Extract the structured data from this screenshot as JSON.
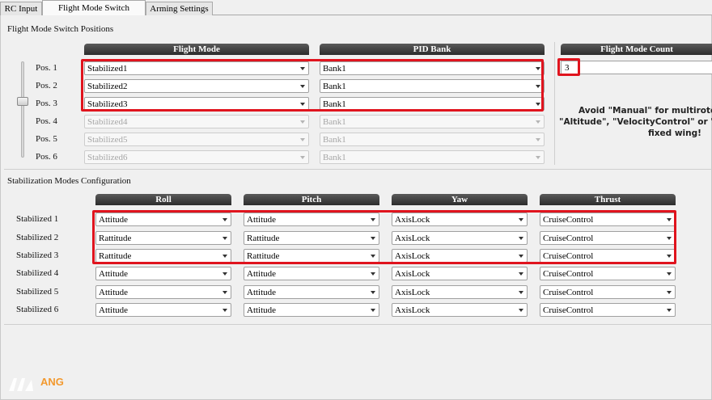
{
  "tabs": [
    {
      "label": "RC Input",
      "active": false
    },
    {
      "label": "Flight Mode Switch Settings",
      "active": true
    },
    {
      "label": "Arming Settings",
      "active": false
    }
  ],
  "flight_mode_section": {
    "title": "Flight Mode Switch Positions",
    "headers": {
      "flight_mode": "Flight Mode",
      "pid_bank": "PID Bank",
      "count": "Flight Mode Count"
    },
    "positions": [
      {
        "label": "Pos. 1",
        "mode": "Stabilized1",
        "bank": "Bank1",
        "enabled": true
      },
      {
        "label": "Pos. 2",
        "mode": "Stabilized2",
        "bank": "Bank1",
        "enabled": true
      },
      {
        "label": "Pos. 3",
        "mode": "Stabilized3",
        "bank": "Bank1",
        "enabled": true
      },
      {
        "label": "Pos. 4",
        "mode": "Stabilized4",
        "bank": "Bank1",
        "enabled": false
      },
      {
        "label": "Pos. 5",
        "mode": "Stabilized5",
        "bank": "Bank1",
        "enabled": false
      },
      {
        "label": "Pos. 6",
        "mode": "Stabilized6",
        "bank": "Bank1",
        "enabled": false
      }
    ],
    "flight_mode_count": "3",
    "warning_lines": [
      "Avoid \"Manual\" for multirotors!",
      "\"Altitude\", \"VelocityControl\" or \"Cr",
      "fixed wing!"
    ]
  },
  "stabilization_section": {
    "title": "Stabilization Modes Configuration",
    "headers": {
      "roll": "Roll",
      "pitch": "Pitch",
      "yaw": "Yaw",
      "thrust": "Thrust"
    },
    "rows": [
      {
        "label": "Stabilized 1",
        "roll": "Attitude",
        "pitch": "Attitude",
        "yaw": "AxisLock",
        "thrust": "CruiseControl"
      },
      {
        "label": "Stabilized 2",
        "roll": "Rattitude",
        "pitch": "Rattitude",
        "yaw": "AxisLock",
        "thrust": "CruiseControl"
      },
      {
        "label": "Stabilized 3",
        "roll": "Rattitude",
        "pitch": "Rattitude",
        "yaw": "AxisLock",
        "thrust": "CruiseControl"
      },
      {
        "label": "Stabilized 4",
        "roll": "Attitude",
        "pitch": "Attitude",
        "yaw": "AxisLock",
        "thrust": "CruiseControl"
      },
      {
        "label": "Stabilized 5",
        "roll": "Attitude",
        "pitch": "Attitude",
        "yaw": "AxisLock",
        "thrust": "CruiseControl"
      },
      {
        "label": "Stabilized 6",
        "roll": "Attitude",
        "pitch": "Attitude",
        "yaw": "AxisLock",
        "thrust": "CruiseControl"
      }
    ]
  },
  "watermark": {
    "text": "ANG"
  },
  "colors": {
    "highlight": "#e0141e",
    "header_bg": "#3a3a3a"
  }
}
